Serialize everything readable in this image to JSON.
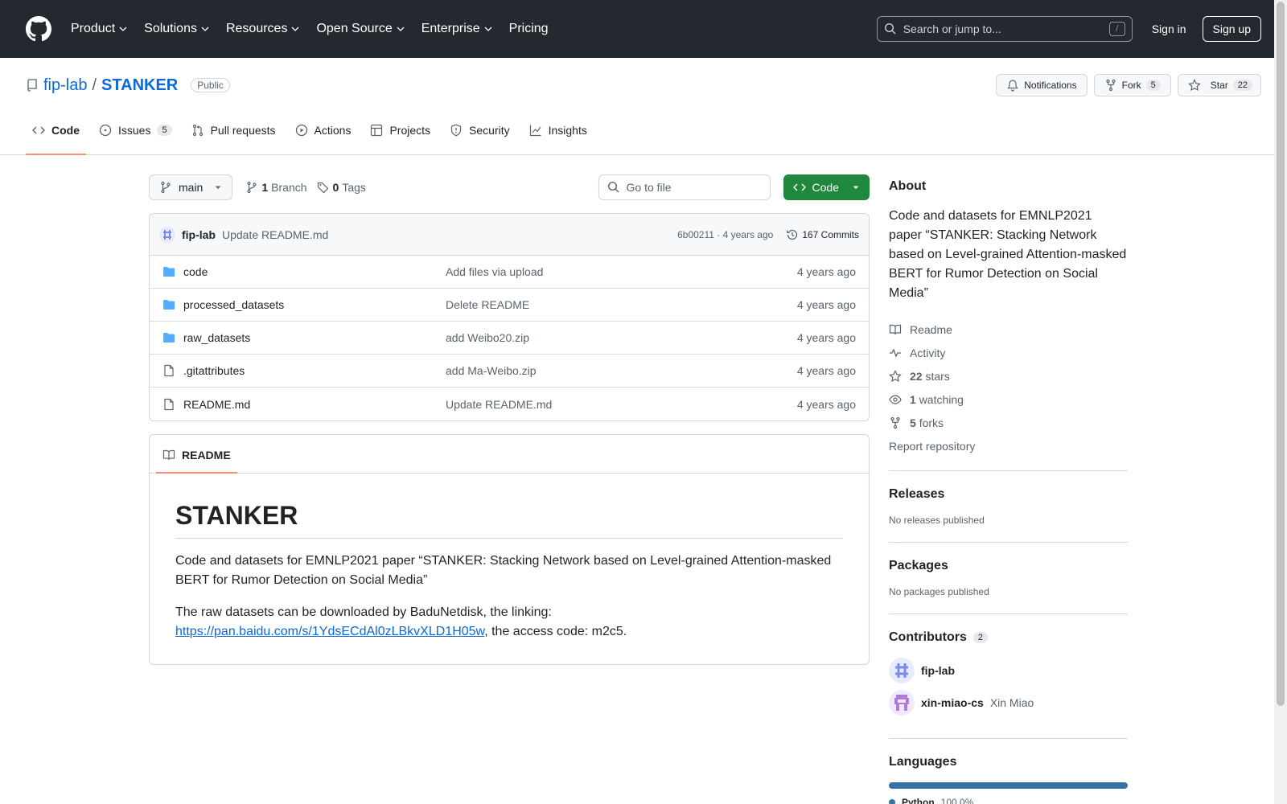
{
  "header": {
    "nav": [
      "Product",
      "Solutions",
      "Resources",
      "Open Source",
      "Enterprise",
      "Pricing"
    ],
    "search_placeholder": "Search or jump to...",
    "search_shortcut": "/",
    "sign_in": "Sign in",
    "sign_up": "Sign up"
  },
  "repo": {
    "owner": "fip-lab",
    "separator": "/",
    "name": "STANKER",
    "visibility": "Public",
    "notifications_label": "Notifications",
    "fork_label": "Fork",
    "fork_count": "5",
    "star_label": "Star",
    "star_count": "22"
  },
  "tabs": [
    {
      "label": "Code",
      "icon": "code-icon"
    },
    {
      "label": "Issues",
      "icon": "issue-icon",
      "count": "5"
    },
    {
      "label": "Pull requests",
      "icon": "pull-request-icon"
    },
    {
      "label": "Actions",
      "icon": "play-icon"
    },
    {
      "label": "Projects",
      "icon": "table-icon"
    },
    {
      "label": "Security",
      "icon": "shield-icon"
    },
    {
      "label": "Insights",
      "icon": "graph-icon"
    }
  ],
  "toolbar": {
    "branch": "main",
    "branch_count": "1",
    "branch_label": "Branch",
    "tag_count": "0",
    "tag_label": "Tags",
    "goto_placeholder": "Go to file",
    "code_button": "Code"
  },
  "commit": {
    "author": "fip-lab",
    "message": "Update README.md",
    "hash_time": "6b00211 · 4 years ago",
    "count_label": "167 Commits"
  },
  "files": [
    {
      "name": "code",
      "type": "folder",
      "message": "Add files via upload",
      "time": "4 years ago"
    },
    {
      "name": "processed_datasets",
      "type": "folder",
      "message": "Delete README",
      "time": "4 years ago"
    },
    {
      "name": "raw_datasets",
      "type": "folder",
      "message": "add Weibo20.zip",
      "time": "4 years ago"
    },
    {
      "name": ".gitattributes",
      "type": "file",
      "message": "add Ma-Weibo.zip",
      "time": "4 years ago"
    },
    {
      "name": "README.md",
      "type": "file",
      "message": "Update README.md",
      "time": "4 years ago"
    }
  ],
  "readme": {
    "tab_label": "README",
    "title": "STANKER",
    "paragraph1": "Code and datasets for EMNLP2021 paper “STANKER: Stacking Network based on Level-grained Attention-masked BERT for Rumor Detection on Social Media”",
    "paragraph2_prefix": "The raw datasets can be downloaded by BaduNetdisk, the linking:",
    "link": "https://pan.baidu.com/s/1YdsECdAl0zLBkvXLD1H05w",
    "paragraph2_suffix": ", the access code: m2c5."
  },
  "sidebar": {
    "about_title": "About",
    "about_desc": "Code and datasets for EMNLP2021 paper “STANKER: Stacking Network based on Level-grained Attention-masked BERT for Rumor Detection on Social Media”",
    "readme": "Readme",
    "activity": "Activity",
    "stars_count": "22",
    "stars_label": "stars",
    "watching_count": "1",
    "watching_label": "watching",
    "forks_count": "5",
    "forks_label": "forks",
    "report": "Report repository",
    "releases_title": "Releases",
    "releases_none": "No releases published",
    "packages_title": "Packages",
    "packages_none": "No packages published",
    "contributors_title": "Contributors",
    "contributors_count": "2",
    "contributors": [
      {
        "login": "fip-lab",
        "name": ""
      },
      {
        "login": "xin-miao-cs",
        "name": "Xin Miao"
      }
    ],
    "languages_title": "Languages",
    "language": "Python",
    "language_pct": "100.0%",
    "language_color": "#3572A5"
  }
}
